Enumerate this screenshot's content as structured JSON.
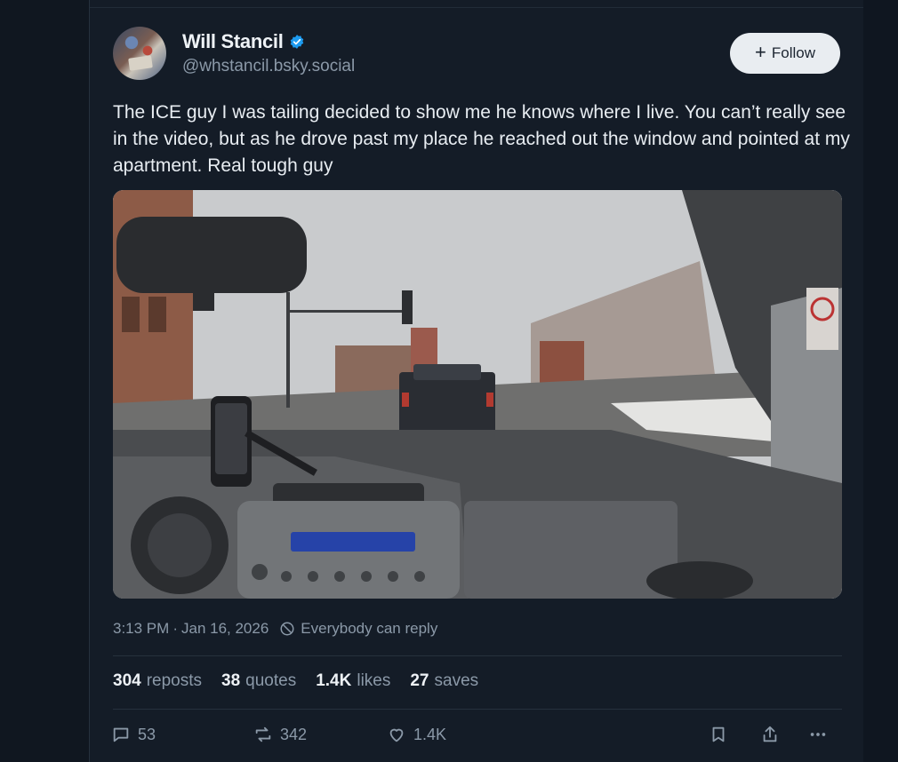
{
  "author": {
    "display_name": "Will Stancil",
    "handle": "@whstancil.bsky.social",
    "verified_icon": "verified-badge-icon"
  },
  "follow_button": {
    "label": "Follow",
    "icon": "plus-icon"
  },
  "post": {
    "text": "The ICE guy I was tailing decided to show me he knows where I live. You can’t really see in the video, but as he drove past my place he reached out the window and pointed at my apartment. Real tough guy",
    "media": "video-still-car-dashboard",
    "time": "3:13 PM",
    "separator": "·",
    "date": "Jan 16, 2026",
    "reply_setting": "Everybody can reply"
  },
  "stats": {
    "reposts_count": "304",
    "reposts_label": "reposts",
    "quotes_count": "38",
    "quotes_label": "quotes",
    "likes_count": "1.4K",
    "likes_label": "likes",
    "saves_count": "27",
    "saves_label": "saves"
  },
  "actions": {
    "reply_count": "53",
    "repost_count": "342",
    "like_count": "1.4K"
  },
  "colors": {
    "background": "#0f1620",
    "card": "#141c27",
    "accent_blue": "#1d9bf0",
    "muted_text": "#8b99a8"
  }
}
